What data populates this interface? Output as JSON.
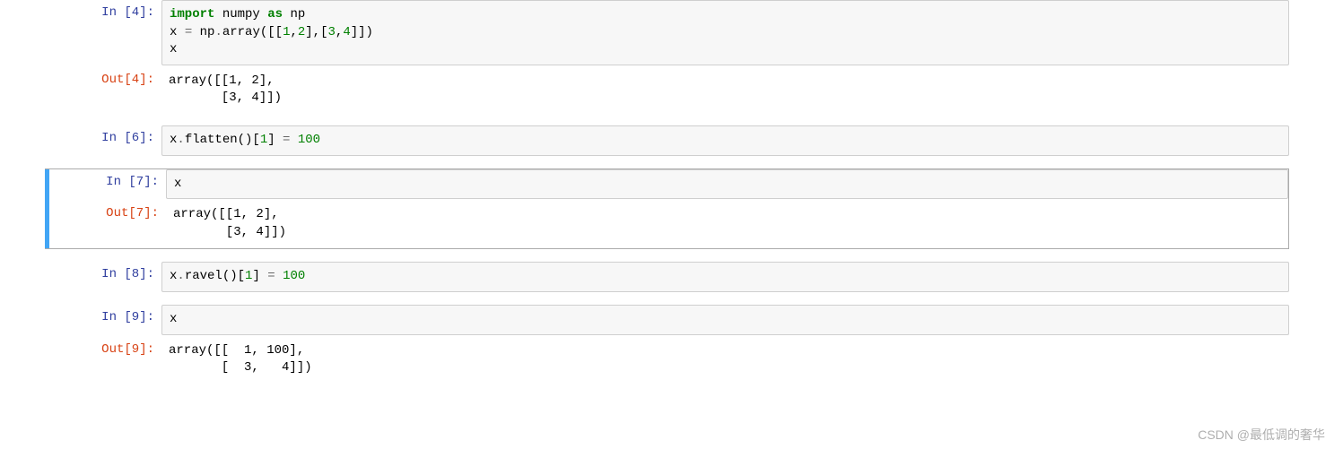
{
  "cells": [
    {
      "type": "input",
      "promptPrefix": "In  [",
      "num": "4",
      "promptSuffix": "]:",
      "code": {
        "tokens": [
          {
            "t": "import",
            "c": "kw"
          },
          {
            "t": " numpy ",
            "c": "pln"
          },
          {
            "t": "as",
            "c": "kw"
          },
          {
            "t": " np\n",
            "c": "pln"
          },
          {
            "t": "x ",
            "c": "pln"
          },
          {
            "t": "=",
            "c": "op"
          },
          {
            "t": " np",
            "c": "pln"
          },
          {
            "t": ".",
            "c": "op"
          },
          {
            "t": "array([[",
            "c": "pln"
          },
          {
            "t": "1",
            "c": "num"
          },
          {
            "t": ",",
            "c": "pln"
          },
          {
            "t": "2",
            "c": "num"
          },
          {
            "t": "],[",
            "c": "pln"
          },
          {
            "t": "3",
            "c": "num"
          },
          {
            "t": ",",
            "c": "pln"
          },
          {
            "t": "4",
            "c": "num"
          },
          {
            "t": "]])\n",
            "c": "pln"
          },
          {
            "t": "x",
            "c": "pln"
          }
        ]
      }
    },
    {
      "type": "output",
      "promptPrefix": "Out[",
      "num": "4",
      "promptSuffix": "]:",
      "text": "array([[1, 2],\n       [3, 4]])"
    },
    {
      "type": "input",
      "promptPrefix": "In  [",
      "num": "6",
      "promptSuffix": "]:",
      "code": {
        "tokens": [
          {
            "t": "x",
            "c": "pln"
          },
          {
            "t": ".",
            "c": "op"
          },
          {
            "t": "flatten()[",
            "c": "pln"
          },
          {
            "t": "1",
            "c": "num"
          },
          {
            "t": "] ",
            "c": "pln"
          },
          {
            "t": "=",
            "c": "op"
          },
          {
            "t": " ",
            "c": "pln"
          },
          {
            "t": "100",
            "c": "num"
          }
        ]
      }
    },
    {
      "type": "input",
      "selected": true,
      "promptPrefix": "In  [",
      "num": "7",
      "promptSuffix": "]:",
      "code": {
        "tokens": [
          {
            "t": "x",
            "c": "pln"
          }
        ]
      }
    },
    {
      "type": "output",
      "selected": true,
      "promptPrefix": "Out[",
      "num": "7",
      "promptSuffix": "]:",
      "text": "array([[1, 2],\n       [3, 4]])"
    },
    {
      "type": "input",
      "promptPrefix": "In  [",
      "num": "8",
      "promptSuffix": "]:",
      "code": {
        "tokens": [
          {
            "t": "x",
            "c": "pln"
          },
          {
            "t": ".",
            "c": "op"
          },
          {
            "t": "ravel()[",
            "c": "pln"
          },
          {
            "t": "1",
            "c": "num"
          },
          {
            "t": "] ",
            "c": "pln"
          },
          {
            "t": "=",
            "c": "op"
          },
          {
            "t": " ",
            "c": "pln"
          },
          {
            "t": "100",
            "c": "num"
          }
        ]
      }
    },
    {
      "type": "input",
      "promptPrefix": "In  [",
      "num": "9",
      "promptSuffix": "]:",
      "code": {
        "tokens": [
          {
            "t": "x",
            "c": "pln"
          }
        ]
      }
    },
    {
      "type": "output",
      "promptPrefix": "Out[",
      "num": "9",
      "promptSuffix": "]:",
      "text": "array([[  1, 100],\n       [  3,   4]])"
    }
  ],
  "watermark": "CSDN @最低调的奢华"
}
